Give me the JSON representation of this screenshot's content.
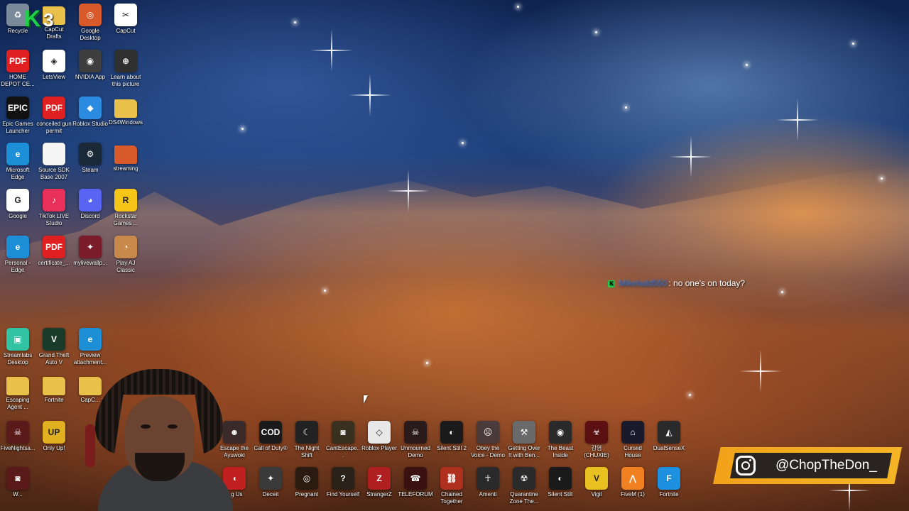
{
  "desktop": {
    "left_icons": [
      {
        "label": "Recycle",
        "icon": "recycle-bin-icon",
        "color": "#7a8a9a",
        "glyph": "♻"
      },
      {
        "label": "CapCut Drafts",
        "icon": "folder-icon",
        "color": "#e8c04a",
        "glyph": ""
      },
      {
        "label": "Google Desktop",
        "icon": "google-desktop-icon",
        "color": "#d85a2a",
        "glyph": "◎"
      },
      {
        "label": "CapCut",
        "icon": "capcut-icon",
        "color": "#ffffff",
        "glyph": "✂"
      },
      {
        "label": "HOME DEPOT CE...",
        "icon": "pdf-icon",
        "color": "#e02020",
        "glyph": "PDF"
      },
      {
        "label": "LetsView",
        "icon": "letsview-icon",
        "color": "#ffffff",
        "glyph": "◈"
      },
      {
        "label": "NVIDIA App",
        "icon": "nvidia-icon",
        "color": "#3e3e3e",
        "glyph": "◉"
      },
      {
        "label": "Learn about this picture",
        "icon": "learn-about-picture-icon",
        "color": "#303030",
        "glyph": "⊕"
      },
      {
        "label": "Epic Games Launcher",
        "icon": "epic-games-icon",
        "color": "#111111",
        "glyph": "EPIC"
      },
      {
        "label": "conceiled gun permit",
        "icon": "pdf-icon",
        "color": "#e02020",
        "glyph": "PDF"
      },
      {
        "label": "Roblox Studio",
        "icon": "roblox-studio-icon",
        "color": "#2b8be0",
        "glyph": "◆"
      },
      {
        "label": "DS4Windows",
        "icon": "folder-icon",
        "color": "#e8c04a",
        "glyph": ""
      },
      {
        "label": "Microsoft Edge",
        "icon": "edge-icon",
        "color": "#1d8fd6",
        "glyph": "e"
      },
      {
        "label": "Source SDK Base 2007",
        "icon": "document-icon",
        "color": "#f5f5f5",
        "glyph": ""
      },
      {
        "label": "Steam",
        "icon": "steam-icon",
        "color": "#1b2838",
        "glyph": "⚙"
      },
      {
        "label": "streaming",
        "icon": "folder-icon",
        "color": "#d85a2a",
        "glyph": ""
      },
      {
        "label": "Google",
        "icon": "google-icon",
        "color": "#ffffff",
        "glyph": "G"
      },
      {
        "label": "TikTok LIVE Studio",
        "icon": "tiktok-icon",
        "color": "#e8305a",
        "glyph": "♪"
      },
      {
        "label": "Discord",
        "icon": "discord-icon",
        "color": "#5865f2",
        "glyph": "◕"
      },
      {
        "label": "Rockstar Games ...",
        "icon": "rockstar-icon",
        "color": "#f5c518",
        "glyph": "R"
      },
      {
        "label": "Personal - Edge",
        "icon": "edge-icon",
        "color": "#1d8fd6",
        "glyph": "e"
      },
      {
        "label": "certificate_...",
        "icon": "pdf-icon",
        "color": "#e02020",
        "glyph": "PDF"
      },
      {
        "label": "mylivewallp...",
        "icon": "wallpaper-icon",
        "color": "#7a1c2a",
        "glyph": "✦"
      },
      {
        "label": "Play AJ Classic",
        "icon": "animal-jam-icon",
        "color": "#c88a4a",
        "glyph": "◔"
      },
      {
        "label": "Streamlabs Desktop",
        "icon": "streamlabs-icon",
        "color": "#31c3a2",
        "glyph": "▣"
      },
      {
        "label": "Grand Theft Auto V",
        "icon": "gta-icon",
        "color": "#1a3a2a",
        "glyph": "V"
      },
      {
        "label": "Preview attachment...",
        "icon": "edge-icon",
        "color": "#1d8fd6",
        "glyph": "e"
      },
      {
        "label": "Escaping Agent ...",
        "icon": "folder-icon",
        "color": "#e8c04a",
        "glyph": ""
      },
      {
        "label": "Fortnite",
        "icon": "folder-icon",
        "color": "#e8c04a",
        "glyph": ""
      },
      {
        "label": "CapC...",
        "icon": "folder-icon",
        "color": "#e8c04a",
        "glyph": ""
      },
      {
        "label": "FiveNightsa...",
        "icon": "fnaf-icon",
        "color": "#5a1a1a",
        "glyph": "☠"
      },
      {
        "label": "Only Up!",
        "icon": "only-up-icon",
        "color": "#e0b020",
        "glyph": "UP"
      },
      {
        "label": "W...",
        "icon": "game-icon",
        "color": "#5a1a1a",
        "glyph": "◙"
      }
    ],
    "bottom_row1": [
      {
        "label": "Escape the Ayuwoki",
        "icon": "game-icon",
        "color": "#3a2a2a",
        "glyph": "☻"
      },
      {
        "label": "Call of Duty®",
        "icon": "call-of-duty-icon",
        "color": "#1a1a1a",
        "glyph": "COD"
      },
      {
        "label": "The Night Shift",
        "icon": "game-icon",
        "color": "#222222",
        "glyph": "☾"
      },
      {
        "label": "CantEscape...",
        "icon": "game-icon",
        "color": "#3a3020",
        "glyph": "◙"
      },
      {
        "label": "Roblox Player",
        "icon": "roblox-icon",
        "color": "#e8e8e8",
        "glyph": "◇"
      },
      {
        "label": "Unmourned Demo",
        "icon": "game-icon",
        "color": "#2a1a1a",
        "glyph": "☠"
      },
      {
        "label": "Silent Still 2",
        "icon": "game-icon",
        "color": "#1a1a1a",
        "glyph": "◐"
      },
      {
        "label": "Obey the Voice - Demo",
        "icon": "game-icon",
        "color": "#4a3a3a",
        "glyph": "☹"
      },
      {
        "label": "Getting Over It with Ben...",
        "icon": "hammer-icon",
        "color": "#6a6a6a",
        "glyph": "⚒"
      },
      {
        "label": "The Beast Inside",
        "icon": "game-icon",
        "color": "#2a2a2a",
        "glyph": "◉"
      },
      {
        "label": "감염 (CHUXIE)",
        "icon": "game-icon",
        "color": "#5a1010",
        "glyph": "☣"
      },
      {
        "label": "Cursed House",
        "icon": "cursed-house-icon",
        "color": "#1a1a2a",
        "glyph": "⌂"
      },
      {
        "label": "DualSenseX",
        "icon": "controller-icon",
        "color": "#2a2a2a",
        "glyph": "◭"
      }
    ],
    "bottom_row2": [
      {
        "label": "...g Us",
        "icon": "among-us-icon",
        "color": "#c02020",
        "glyph": "◖"
      },
      {
        "label": "Deceit",
        "icon": "deceit-icon",
        "color": "#3a3a3a",
        "glyph": "✦"
      },
      {
        "label": "Pregnant",
        "icon": "game-icon",
        "color": "#2a1a10",
        "glyph": "◎"
      },
      {
        "label": "Find Yourself",
        "icon": "game-icon",
        "color": "#2a2218",
        "glyph": "?"
      },
      {
        "label": "StrangerZ",
        "icon": "game-icon",
        "color": "#b02020",
        "glyph": "Z"
      },
      {
        "label": "TELEFORUM",
        "icon": "game-icon",
        "color": "#3a1010",
        "glyph": "☎"
      },
      {
        "label": "Chained Together",
        "icon": "game-icon",
        "color": "#b03020",
        "glyph": "⛓"
      },
      {
        "label": "Amenti",
        "icon": "game-icon",
        "color": "#2a2a2a",
        "glyph": "☥"
      },
      {
        "label": "Quarantine Zone The...",
        "icon": "game-icon",
        "color": "#2a2a2a",
        "glyph": "☢"
      },
      {
        "label": "Silent Still",
        "icon": "game-icon",
        "color": "#1a1a1a",
        "glyph": "◐"
      },
      {
        "label": "Vigil",
        "icon": "vigil-icon",
        "color": "#e8c020",
        "glyph": "V"
      },
      {
        "label": "FiveM (1)",
        "icon": "fivem-icon",
        "color": "#f08020",
        "glyph": "⋀"
      },
      {
        "label": "Fortnite",
        "icon": "fortnite-icon",
        "color": "#1e90e0",
        "glyph": "F"
      }
    ]
  },
  "overlay": {
    "logo_letter": "K",
    "logo_number": "3",
    "chat": {
      "username": "Mikeladd550",
      "message": ": no one's on today?"
    },
    "social": {
      "handle": "@ChopTheDon_"
    }
  }
}
